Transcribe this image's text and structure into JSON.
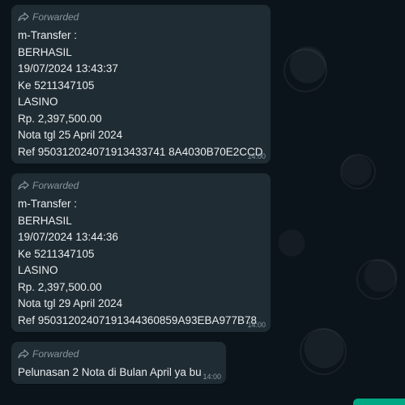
{
  "messages": [
    {
      "forwarded_label": "Forwarded",
      "lines": [
        "m-Transfer :",
        "BERHASIL",
        "19/07/2024 13:43:37",
        "Ke 5211347105",
        "LASINO",
        "Rp. 2,397,500.00",
        "Nota tgl 25 April 2024",
        "Ref 950312024071913433741 8A4030B70E2CCD"
      ],
      "time": "14:00"
    },
    {
      "forwarded_label": "Forwarded",
      "lines": [
        "m-Transfer :",
        "BERHASIL",
        "19/07/2024 13:44:36",
        "Ke 5211347105",
        "LASINO",
        "Rp. 2,397,500.00",
        "Nota tgl 29 April 2024",
        "Ref 95031202407191344360859A93EBA977B78"
      ],
      "time": "14:00"
    },
    {
      "forwarded_label": "Forwarded",
      "lines": [
        "Pelunasan 2 Nota di Bulan April ya bu"
      ],
      "time": "14:00"
    }
  ],
  "icons": {
    "forward": "forward-icon"
  },
  "colors": {
    "background": "#0b141a",
    "bubble": "#202c33",
    "text": "#e9edef",
    "meta": "#8696a0",
    "accent": "#00a884"
  }
}
